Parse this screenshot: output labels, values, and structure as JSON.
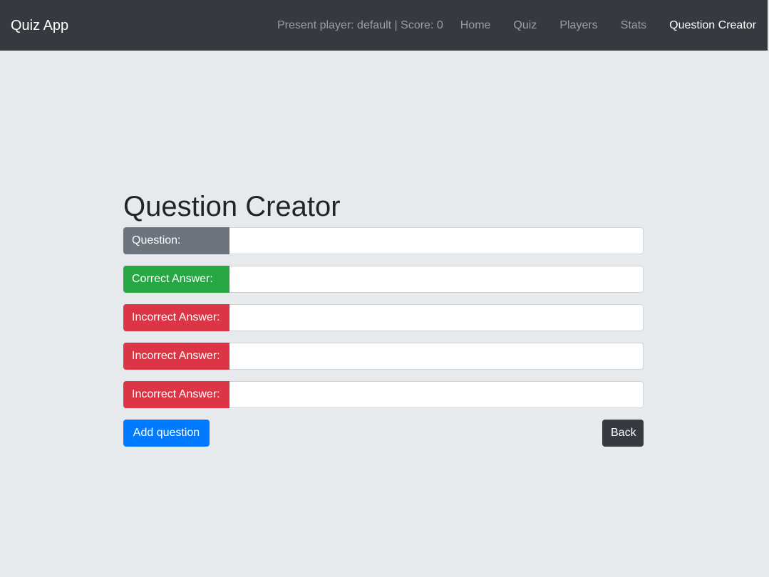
{
  "navbar": {
    "brand": "Quiz App",
    "player_status": "Present player: default | Score: 0",
    "links": [
      {
        "label": "Home"
      },
      {
        "label": "Quiz"
      },
      {
        "label": "Players"
      },
      {
        "label": "Stats"
      },
      {
        "label": "Question Creator"
      }
    ],
    "active_link": "Question Creator"
  },
  "main": {
    "title": "Question Creator",
    "fields": [
      {
        "label": "Question:",
        "value": "",
        "color": "#6c757d"
      },
      {
        "label": "Correct Answer:",
        "value": "",
        "color": "#28a745"
      },
      {
        "label": "Incorrect Answer:",
        "value": "",
        "color": "#dc3545"
      },
      {
        "label": "Incorrect Answer:",
        "value": "",
        "color": "#dc3545"
      },
      {
        "label": "Incorrect Answer:",
        "value": "",
        "color": "#dc3545"
      }
    ],
    "add_button_label": "Add question",
    "back_button_label": "Back"
  },
  "colors": {
    "navbar_bg": "#343a40",
    "page_bg": "#e7eaed",
    "primary": "#007bff",
    "success": "#28a745",
    "danger": "#dc3545",
    "secondary": "#6c757d"
  }
}
